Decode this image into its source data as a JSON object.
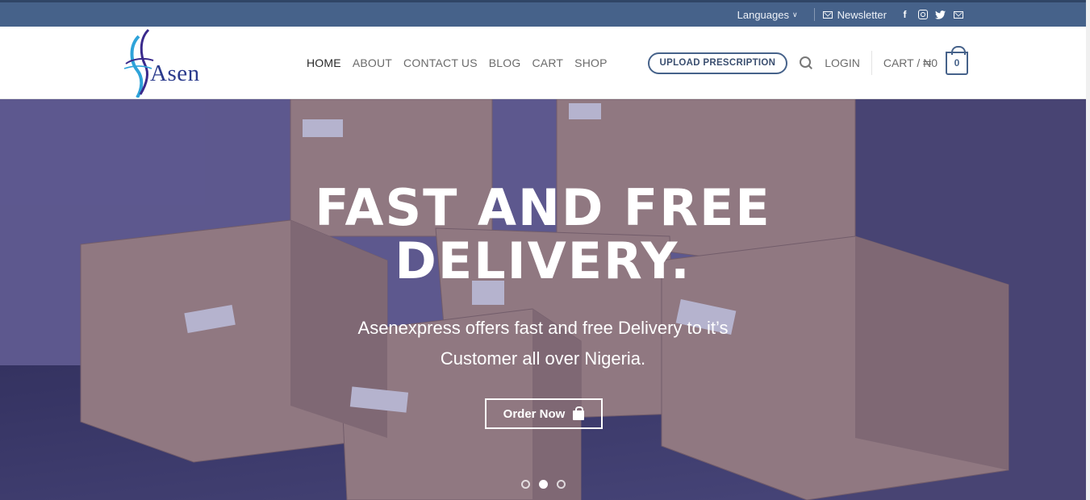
{
  "topbar": {
    "languages_label": "Languages",
    "newsletter_label": "Newsletter",
    "social": [
      "facebook-icon",
      "instagram-icon",
      "twitter-icon",
      "email-icon"
    ]
  },
  "header": {
    "logo_text": "Asen",
    "nav": [
      {
        "label": "HOME",
        "active": true
      },
      {
        "label": "ABOUT"
      },
      {
        "label": "CONTACT US"
      },
      {
        "label": "BLOG"
      },
      {
        "label": "CART"
      },
      {
        "label": "SHOP"
      }
    ],
    "upload_prescription_label": "UPLOAD PRESCRIPTION",
    "login_label": "LOGIN",
    "cart_label": "CART / ₦0",
    "cart_count": "0"
  },
  "hero": {
    "title_line1": "FAST AND FREE",
    "title_line2": "DELIVERY.",
    "subtitle": "Asenexpress offers fast and free Delivery to it’s Customer all over Nigeria.",
    "button_label": "Order Now",
    "slides": 3,
    "active_slide": 2
  },
  "colors": {
    "topbar": "#46628a",
    "accent": "#46628a",
    "overlay": "#463e8c"
  }
}
